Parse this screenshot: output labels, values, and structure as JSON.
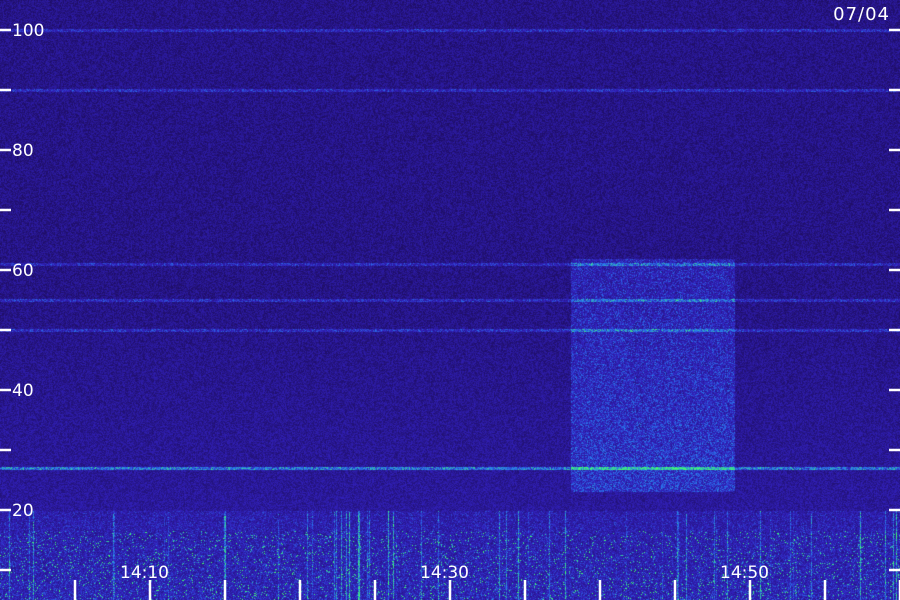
{
  "chart_data": {
    "type": "heatmap",
    "title": "",
    "date": "07/04",
    "y_ticks": [
      {
        "value": 100,
        "label": "100"
      },
      {
        "value": 90,
        "label": ""
      },
      {
        "value": 80,
        "label": "80"
      },
      {
        "value": 70,
        "label": ""
      },
      {
        "value": 60,
        "label": "60"
      },
      {
        "value": 50,
        "label": ""
      },
      {
        "value": 40,
        "label": "40"
      },
      {
        "value": 30,
        "label": ""
      },
      {
        "value": 20,
        "label": "20"
      },
      {
        "value": 10,
        "label": ""
      }
    ],
    "ylim": [
      10,
      100
    ],
    "x_ticks": [
      {
        "minutes": 5,
        "label": ""
      },
      {
        "minutes": 10,
        "label": "14:10"
      },
      {
        "minutes": 15,
        "label": ""
      },
      {
        "minutes": 20,
        "label": ""
      },
      {
        "minutes": 25,
        "label": ""
      },
      {
        "minutes": 30,
        "label": "14:30"
      },
      {
        "minutes": 35,
        "label": ""
      },
      {
        "minutes": 40,
        "label": ""
      },
      {
        "minutes": 45,
        "label": ""
      },
      {
        "minutes": 50,
        "label": "14:50"
      },
      {
        "minutes": 55,
        "label": ""
      },
      {
        "minutes": 60,
        "label": ""
      }
    ],
    "x_range_minutes_after_1400": [
      0,
      60
    ],
    "colors": {
      "background": "#1e0d63",
      "mid": "#2a3fd6",
      "high": "#2ae0e0",
      "peak": "#40ff70"
    },
    "features": {
      "horizontal_lines_at": [
        100,
        90,
        61,
        55,
        50,
        27
      ],
      "broadband_patch_minutes": [
        38,
        49
      ],
      "broadband_patch_range": [
        23,
        62
      ],
      "low_band_activity_below": 20
    }
  }
}
